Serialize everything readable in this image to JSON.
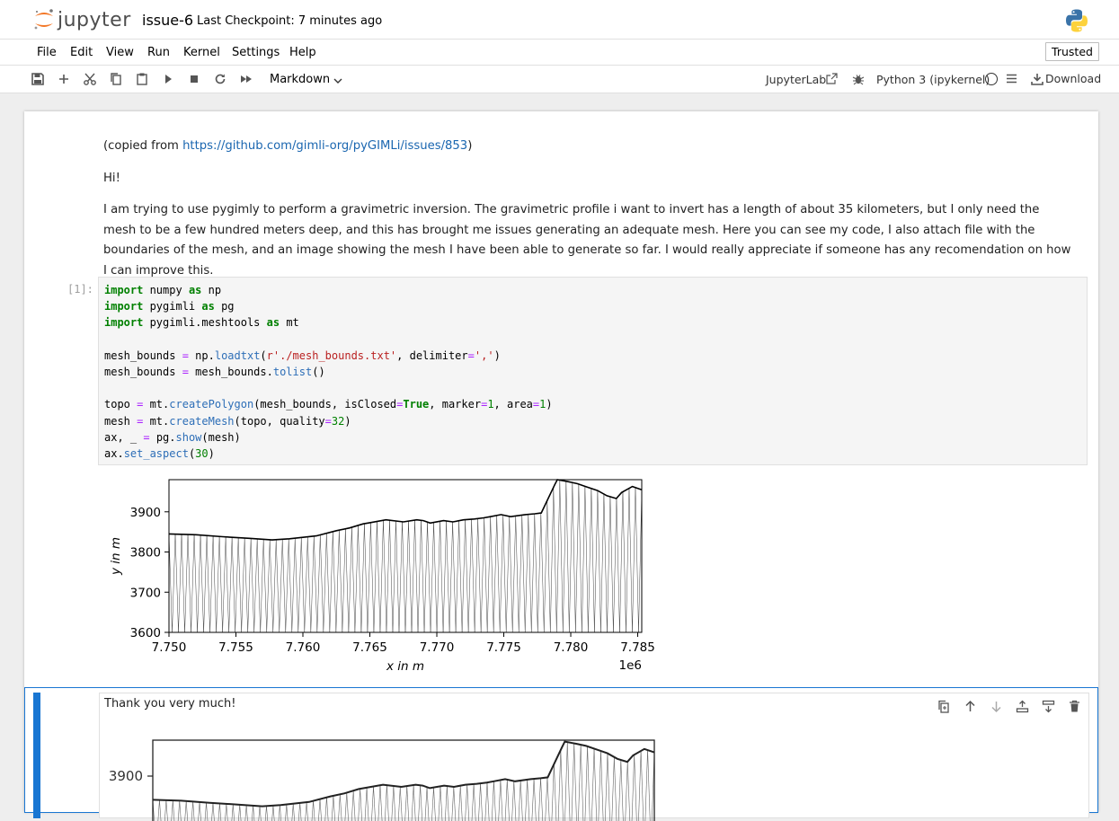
{
  "header": {
    "logo_text": "jupyter",
    "notebook_title": "issue-6",
    "checkpoint": "Last Checkpoint: 7 minutes ago"
  },
  "menu": {
    "items": [
      "File",
      "Edit",
      "View",
      "Run",
      "Kernel",
      "Settings",
      "Help"
    ],
    "trusted": "Trusted"
  },
  "toolbar": {
    "cell_type": "Markdown",
    "jupyterlab": "JupyterLab",
    "kernel": "Python 3 (ipykernel)",
    "download": "Download"
  },
  "markdown_cell": {
    "copied_prefix": "(copied from ",
    "link": "https://github.com/gimli-org/pyGIMLi/issues/853",
    "copied_suffix": ")",
    "greeting": "Hi!",
    "body": "I am trying to use pygimly to perform a gravimetric inversion. The gravimetric profile i want to invert has a length of about 35 kilometers, but I only need the mesh to be a few hundred meters deep, and this has brought me issues generating an adequate mesh. Here you can see my code, I also attach file with the boundaries of the mesh, and an image showing the mesh I have been able to generate so far. I would really appreciate if someone has any recomendation on how I can improve this."
  },
  "code_cell": {
    "prompt": "[1]:"
  },
  "active_cell": {
    "text": "Thank you very much!"
  },
  "chart_data": [
    {
      "type": "line",
      "title": "",
      "xlabel": "x in m",
      "ylabel": "y in m",
      "x_offset_label": "1e6",
      "xlim": [
        7.75,
        7.7853
      ],
      "ylim": [
        3600,
        3980
      ],
      "xticks": [
        "7.750",
        "7.755",
        "7.760",
        "7.765",
        "7.770",
        "7.775",
        "7.780",
        "7.785"
      ],
      "yticks": [
        "3600",
        "3700",
        "3800",
        "3900"
      ],
      "series": [
        {
          "x": [
            7.75,
            7.752,
            7.754,
            7.756,
            7.7577,
            7.759,
            7.761,
            7.7625,
            7.7635,
            7.7645,
            7.765,
            7.7662,
            7.7675,
            7.7685,
            7.769,
            7.7695,
            7.7705,
            7.7712,
            7.772,
            7.7728,
            7.7735,
            7.774,
            7.7748,
            7.7755,
            7.7766,
            7.7773,
            7.7778,
            7.7788,
            7.779,
            7.7798,
            7.7805,
            7.7812,
            7.782,
            7.7827,
            7.7834,
            7.7838,
            7.7846,
            7.7853
          ],
          "y": [
            3845,
            3843,
            3838,
            3834,
            3830,
            3833,
            3840,
            3853,
            3860,
            3870,
            3873,
            3880,
            3875,
            3880,
            3878,
            3872,
            3878,
            3875,
            3880,
            3882,
            3885,
            3888,
            3893,
            3888,
            3893,
            3895,
            3897,
            3967,
            3980,
            3975,
            3970,
            3962,
            3953,
            3940,
            3933,
            3948,
            3963,
            3955
          ]
        }
      ]
    },
    {
      "type": "line",
      "title": "",
      "yticks": [
        "3900"
      ]
    }
  ]
}
